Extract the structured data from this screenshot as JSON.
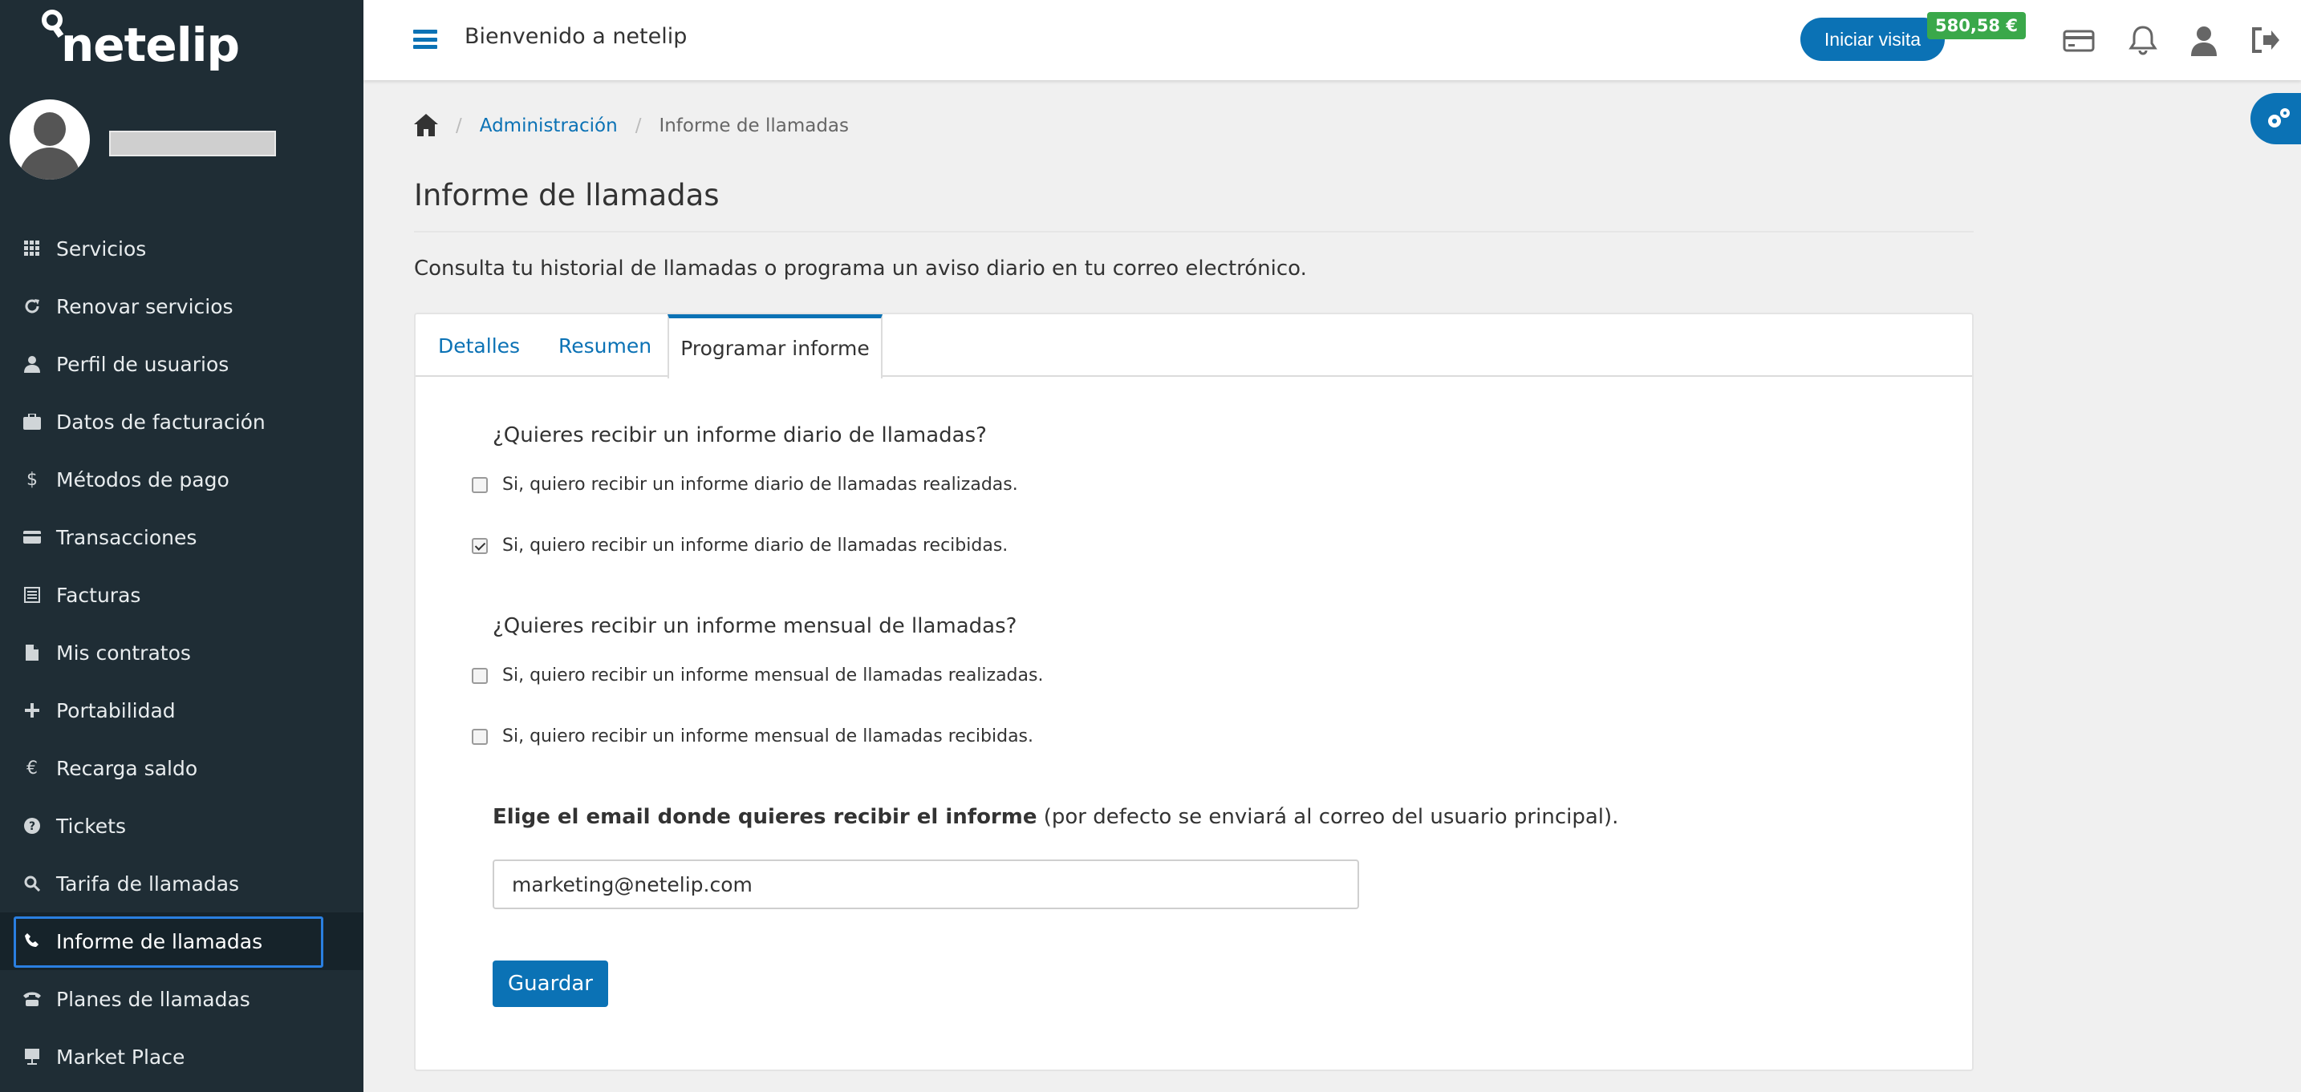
{
  "brand": {
    "name": "netelip"
  },
  "sidebar": {
    "items": [
      {
        "label": "Servicios",
        "icon": "grid-icon"
      },
      {
        "label": "Renovar servicios",
        "icon": "refresh-icon"
      },
      {
        "label": "Perfil de usuarios",
        "icon": "user-icon"
      },
      {
        "label": "Datos de facturación",
        "icon": "briefcase-icon"
      },
      {
        "label": "Métodos de pago",
        "icon": "dollar-icon"
      },
      {
        "label": "Transacciones",
        "icon": "credit-card-icon"
      },
      {
        "label": "Facturas",
        "icon": "invoice-icon"
      },
      {
        "label": "Mis contratos",
        "icon": "file-icon"
      },
      {
        "label": "Portabilidad",
        "icon": "plus-icon"
      },
      {
        "label": "Recarga saldo",
        "icon": "euro-icon"
      },
      {
        "label": "Tickets",
        "icon": "question-icon"
      },
      {
        "label": "Tarifa de llamadas",
        "icon": "search-icon"
      },
      {
        "label": "Informe de llamadas",
        "icon": "phone-icon",
        "active": true
      },
      {
        "label": "Planes de llamadas",
        "icon": "telephone-icon"
      },
      {
        "label": "Market Place",
        "icon": "easel-icon"
      }
    ]
  },
  "topbar": {
    "welcome": "Bienvenido a netelip",
    "visit_button": "Iniciar visita",
    "balance": "580,58 €"
  },
  "breadcrumb": {
    "admin": "Administración",
    "current": "Informe de llamadas"
  },
  "page": {
    "title": "Informe de llamadas",
    "description": "Consulta tu historial de llamadas o programa un aviso diario en tu correo electrónico."
  },
  "tabs": {
    "detalles": "Detalles",
    "resumen": "Resumen",
    "programar": "Programar informe"
  },
  "form": {
    "daily_question": "¿Quieres recibir un informe diario de llamadas?",
    "daily_made": "Si, quiero recibir un informe diario de llamadas realizadas.",
    "daily_received": "Si, quiero recibir un informe diario de llamadas recibidas.",
    "monthly_question": "¿Quieres recibir un informe mensual de llamadas?",
    "monthly_made": "Si, quiero recibir un informe mensual de llamadas realizadas.",
    "monthly_received": "Si, quiero recibir un informe mensual de llamadas recibidas.",
    "email_label_bold": "Elige el email donde quieres recibir el informe",
    "email_label_rest": " (por defecto se enviará al correo del usuario principal).",
    "email_value": "marketing@netelip.com",
    "save_button": "Guardar"
  },
  "colors": {
    "sidebar_bg": "#1f2d35",
    "accent": "#0b72b5",
    "balance_badge": "#3aa84a"
  }
}
